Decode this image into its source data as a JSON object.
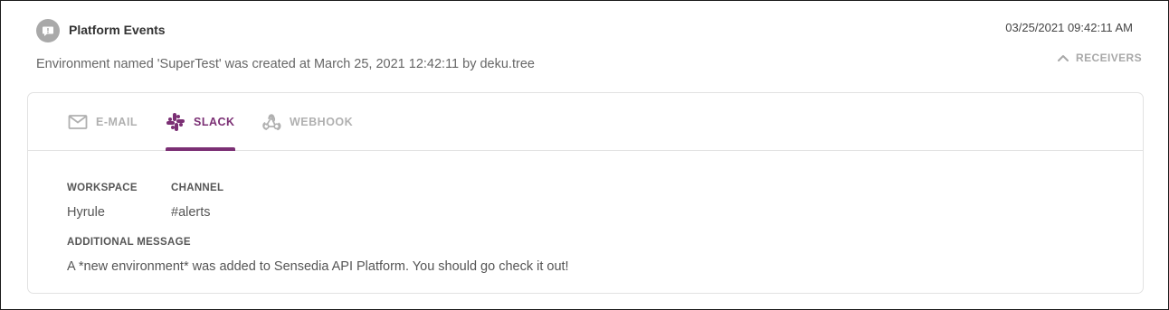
{
  "event": {
    "icon": "alert-icon",
    "title": "Platform Events",
    "timestamp": "03/25/2021 09:42:11 AM",
    "description": "Environment named 'SuperTest' was created at March 25, 2021 12:42:11 by deku.tree"
  },
  "receivers": {
    "toggle_label": "RECEIVERS",
    "toggle_icon": "chevron-up-icon",
    "tabs": [
      {
        "label": "E-MAIL",
        "icon": "mail-icon",
        "active": false
      },
      {
        "label": "SLACK",
        "icon": "slack-icon",
        "active": true
      },
      {
        "label": "WEBHOOK",
        "icon": "webhook-icon",
        "active": false
      }
    ],
    "slack": {
      "workspace_label": "WORKSPACE",
      "workspace_value": "Hyrule",
      "channel_label": "CHANNEL",
      "channel_value": "#alerts",
      "message_label": "ADDITIONAL MESSAGE",
      "message_value": "A *new environment* was added to Sensedia API Platform. You should go check it out!"
    }
  },
  "colors": {
    "accent": "#7b2f74",
    "inactive_tab": "#b0b0b0",
    "icon_bg": "#a9a9a9",
    "border": "#e2e2e2"
  }
}
